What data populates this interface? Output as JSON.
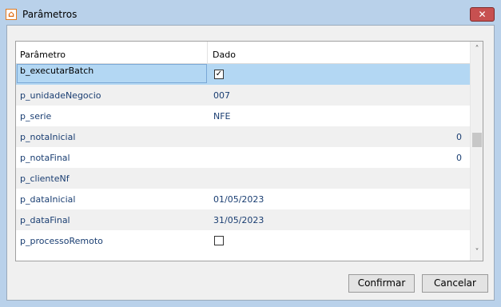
{
  "window": {
    "title": "Parâmetros",
    "app_icon": "app-logo-icon",
    "close_symbol": "✕"
  },
  "grid": {
    "columns": [
      "Parâmetro",
      "Dado"
    ],
    "rows": [
      {
        "param": "b_executarBatch",
        "type": "checkbox",
        "checked": true,
        "selected": true
      },
      {
        "param": "p_unidadeNegocio",
        "dado": "007"
      },
      {
        "param": "p_serie",
        "dado": "NFE"
      },
      {
        "param": "p_notaInicial",
        "num": "0"
      },
      {
        "param": "p_notaFinal",
        "num": "0"
      },
      {
        "param": "p_clienteNf",
        "dado": ""
      },
      {
        "param": "p_dataInicial",
        "dado": "01/05/2023"
      },
      {
        "param": "p_dataFinal",
        "dado": "31/05/2023"
      },
      {
        "param": "p_processoRemoto",
        "type": "checkbox",
        "checked": false
      }
    ]
  },
  "scroll": {
    "up": "˄",
    "down": "˅"
  },
  "buttons": {
    "confirm": "Confirmar",
    "cancel": "Cancelar"
  },
  "colors": {
    "selection": "#b3d7f3",
    "param_text": "#1a3e72",
    "close": "#c75050"
  }
}
